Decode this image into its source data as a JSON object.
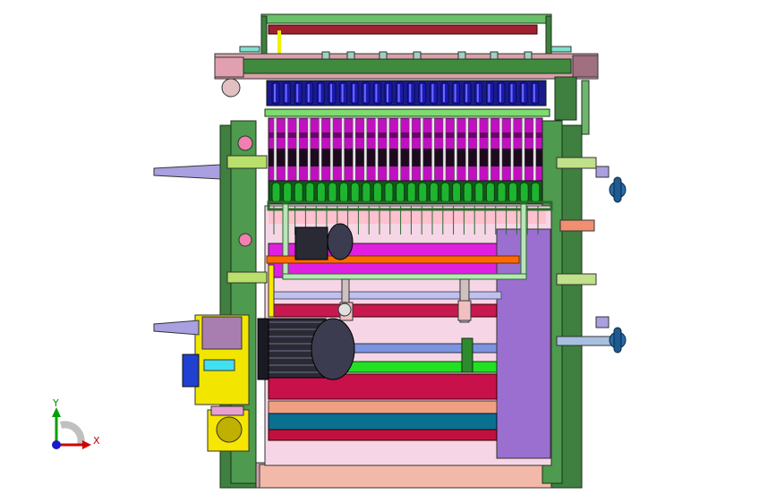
{
  "colors": {
    "frame_green": "#3f7f3f",
    "frame_dark": "#264d26",
    "plate_pink": "#f0b4a0",
    "plate_purple": "#9b6fd0",
    "roller_blue": "#1a1ab0",
    "roller_green": "#1eb430",
    "magenta": "#e010e0",
    "motor_dark": "#2b2b38",
    "gear_yellow": "#f0e000",
    "red_roller": "#c01030",
    "teal_roller": "#008090",
    "shaft_lilac": "#a0a0e8",
    "orange_bar": "#ff6a00"
  },
  "triad": {
    "x_label": "X",
    "y_label": "Y"
  }
}
